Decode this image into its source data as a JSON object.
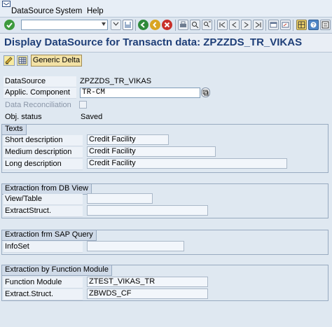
{
  "menu": {
    "items": [
      "DataSource",
      "System",
      "Help"
    ]
  },
  "toolbar": {
    "command_field_value": ""
  },
  "title": "Display DataSource for Transactn data: ZPZZDS_TR_VIKAS",
  "app_toolbar": {
    "generic_delta_label": "Generic Delta"
  },
  "header_fields": {
    "datasource_label": "DataSource",
    "datasource_value": "ZPZZDS_TR_VIKAS",
    "applic_component_label": "Applic. Component",
    "applic_component_value": "TR-CM",
    "data_reconciliation_label": "Data Reconciliation",
    "obj_status_label": "Obj. status",
    "obj_status_value": "Saved"
  },
  "texts": {
    "title": "Texts",
    "short_label": "Short description",
    "short_value": "Credit Facility",
    "medium_label": "Medium description",
    "medium_value": "Credit Facility",
    "long_label": "Long description",
    "long_value": "Credit Facility"
  },
  "db_view": {
    "title": "Extraction from DB View",
    "view_table_label": "View/Table",
    "view_table_value": "",
    "extract_struct_label": "ExtractStruct.",
    "extract_struct_value": ""
  },
  "sap_query": {
    "title": "Extraction frm SAP Query",
    "infoset_label": "InfoSet",
    "infoset_value": ""
  },
  "function_module": {
    "title": "Extraction by Function Module",
    "function_module_label": "Function Module",
    "function_module_value": "ZTEST_VIKAS_TR",
    "extract_struct_label": "Extract.Struct.",
    "extract_struct_value": "ZBWDS_CF"
  },
  "colors": {
    "title_text": "#1f3f78",
    "background": "#dfe8f1",
    "group_header": "#cfdae8"
  }
}
